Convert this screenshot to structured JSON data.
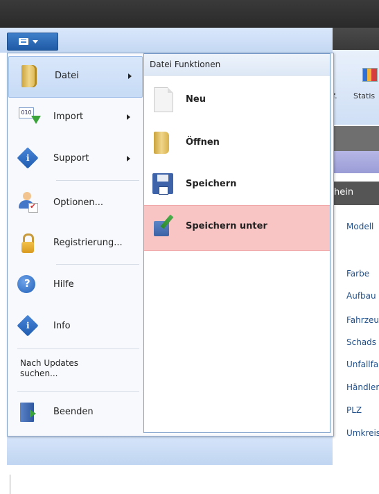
{
  "background": {
    "ribbon": {
      "ref_label": "f.",
      "statistics_label": "Statis"
    },
    "panel_header": "hein",
    "fields": [
      "Modell",
      "Farbe",
      "Aufbau",
      "Fahrzeu",
      "Schads",
      "Unfallfa",
      "Händler",
      "PLZ",
      "Umkreis"
    ]
  },
  "app_menu": {
    "left_items": [
      {
        "label": "Datei",
        "icon": "folder-icon",
        "has_submenu": true,
        "active": true
      },
      {
        "label": "Import",
        "icon": "import-icon",
        "has_submenu": true
      },
      {
        "label": "Support",
        "icon": "info-diamond-icon",
        "has_submenu": true
      },
      {
        "label": "Optionen...",
        "icon": "user-options-icon",
        "has_submenu": false
      },
      {
        "label": "Registrierung...",
        "icon": "lock-icon",
        "has_submenu": false
      },
      {
        "label": "Hilfe",
        "icon": "help-icon",
        "has_submenu": false
      },
      {
        "label": "Info",
        "icon": "info-icon",
        "has_submenu": false
      },
      {
        "label": "Nach Updates suchen...",
        "icon": "",
        "has_submenu": false
      },
      {
        "label": "Beenden",
        "icon": "exit-icon",
        "has_submenu": false
      }
    ],
    "submenu": {
      "title": "Datei Funktionen",
      "items": [
        {
          "label": "Neu",
          "icon": "new-document-icon"
        },
        {
          "label": "Öffnen",
          "icon": "open-folder-icon"
        },
        {
          "label": "Speichern",
          "icon": "save-icon"
        },
        {
          "label": "Speichern unter",
          "icon": "save-as-icon",
          "highlighted": true
        }
      ]
    }
  },
  "colors": {
    "highlight": "#f8c4c4",
    "menu_button": "#2f6cc0"
  }
}
